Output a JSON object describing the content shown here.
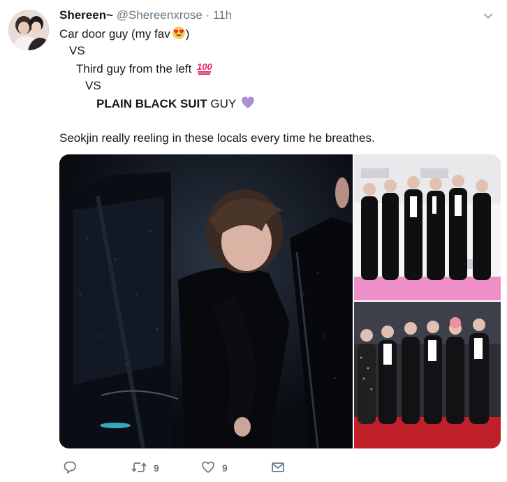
{
  "tweet": {
    "display_name": "Shereen~",
    "handle": "@Shereenxrose",
    "separator": "·",
    "time": "11h",
    "lines": {
      "l1_text": "Car door guy (my fav",
      "l1_close": ")",
      "l2": "VS",
      "l3": "Third guy from the left",
      "l4": "VS",
      "l5_bold": "PLAIN BLACK SUIT",
      "l5_rest": " GUY",
      "l6": "Seokjin really reeling in these locals every time he breathes."
    },
    "icons": {
      "emoji_1": "heart-eyes-emoji",
      "emoji_2": "hundred-points-emoji",
      "emoji_3": "purple-heart-emoji",
      "menu": "chevron-down-icon"
    }
  },
  "actions": {
    "reply_icon": "reply-icon",
    "retweet_icon": "retweet-icon",
    "retweet_count": "9",
    "like_icon": "heart-outline-icon",
    "like_count": "9",
    "dm_icon": "envelope-icon"
  },
  "colors": {
    "text": "#14171a",
    "secondary": "#657786",
    "purple_heart": "#ab91d4",
    "hundred_red": "#e0245e"
  }
}
